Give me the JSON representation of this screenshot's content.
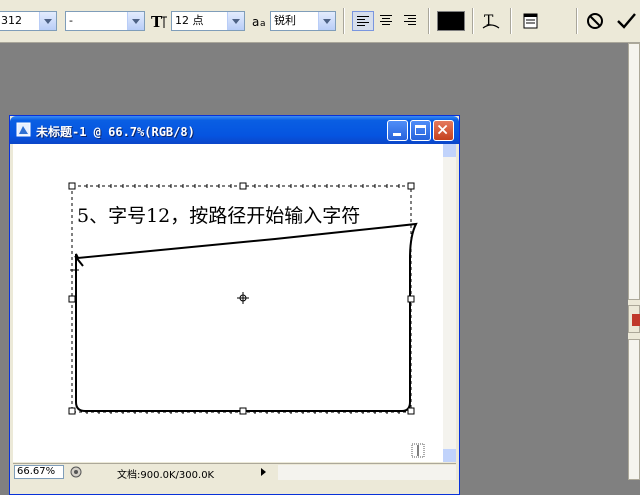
{
  "options_bar": {
    "font_size_partial": "312",
    "font_style": "-",
    "size_value": "12 点",
    "antialias_value": "锐利"
  },
  "document": {
    "title": "未标题-1 @ 66.7%(RGB/8)",
    "canvas_text": "5、字号12，按路径开始输入字符",
    "zoom": "66.67%",
    "doc_info": "文档:900.0K/300.0K"
  },
  "colors": {
    "title_bar": "#0554e0",
    "text_color": "#000000",
    "workspace": "#808080"
  },
  "icons": {
    "text_orientation": "text-orientation-icon",
    "antialias": "antialias-icon",
    "warp_text": "warp-text-icon",
    "palettes": "palettes-icon",
    "cancel": "cancel-icon",
    "commit": "commit-icon",
    "doc_icon": "photoshop-document-icon"
  }
}
